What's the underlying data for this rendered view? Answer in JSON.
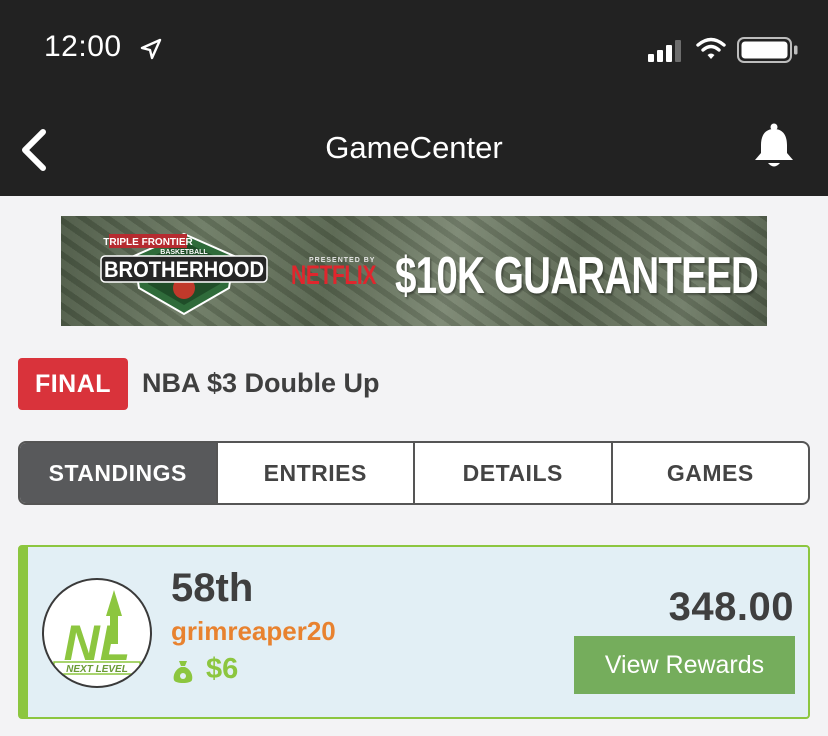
{
  "status_bar": {
    "time": "12:00",
    "icons": [
      "location-arrow-icon",
      "cellular-signal-icon",
      "wifi-icon",
      "battery-icon"
    ]
  },
  "nav": {
    "title": "GameCenter",
    "back_icon": "chevron-left-icon",
    "notification_icon": "bell-icon"
  },
  "banner": {
    "logo_top": "TRIPLE FRONTIER",
    "logo_sub": "BASKETBALL",
    "logo_main": "BROTHERHOOD",
    "presented_by": "PRESENTED BY",
    "sponsor": "NETFLIX",
    "headline": "$10K GUARANTEED"
  },
  "contest": {
    "status": "FINAL",
    "name": "NBA $3 Double Up",
    "status_color": "#d9333b"
  },
  "tabs": [
    {
      "label": "STANDINGS",
      "active": true
    },
    {
      "label": "ENTRIES",
      "active": false
    },
    {
      "label": "DETAILS",
      "active": false
    },
    {
      "label": "GAMES",
      "active": false
    }
  ],
  "entry": {
    "rank": "58th",
    "username": "grimreaper20",
    "winnings": "$6",
    "score": "348.00",
    "rewards_button": "View Rewards",
    "avatar_initials": "NL",
    "avatar_caption": "NEXT LEVEL",
    "accent_color": "#8cc63f",
    "username_color": "#e8822f",
    "button_color": "#75ad5c"
  }
}
